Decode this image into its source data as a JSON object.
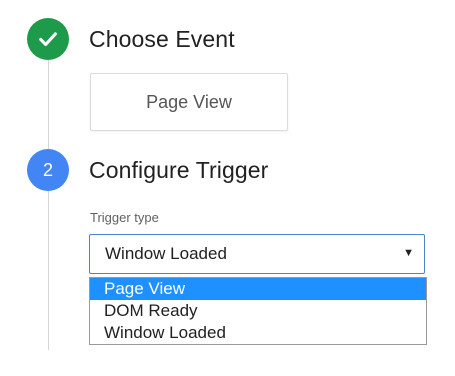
{
  "steps": [
    {
      "status": "complete",
      "icon": "check-icon",
      "title": "Choose Event",
      "color": "#1e9a4b"
    },
    {
      "status": "active",
      "number": "2",
      "title": "Configure Trigger",
      "color": "#4285f4"
    }
  ],
  "event": {
    "selected": "Page View"
  },
  "trigger_type": {
    "label": "Trigger type",
    "value": "Window Loaded",
    "arrow_icon": "dropdown-arrow-icon",
    "options": [
      "Page View",
      "DOM Ready",
      "Window Loaded"
    ],
    "highlighted_option": "Page View",
    "highlight_color": "#1e90ff",
    "border_color": "#4a86c8"
  }
}
